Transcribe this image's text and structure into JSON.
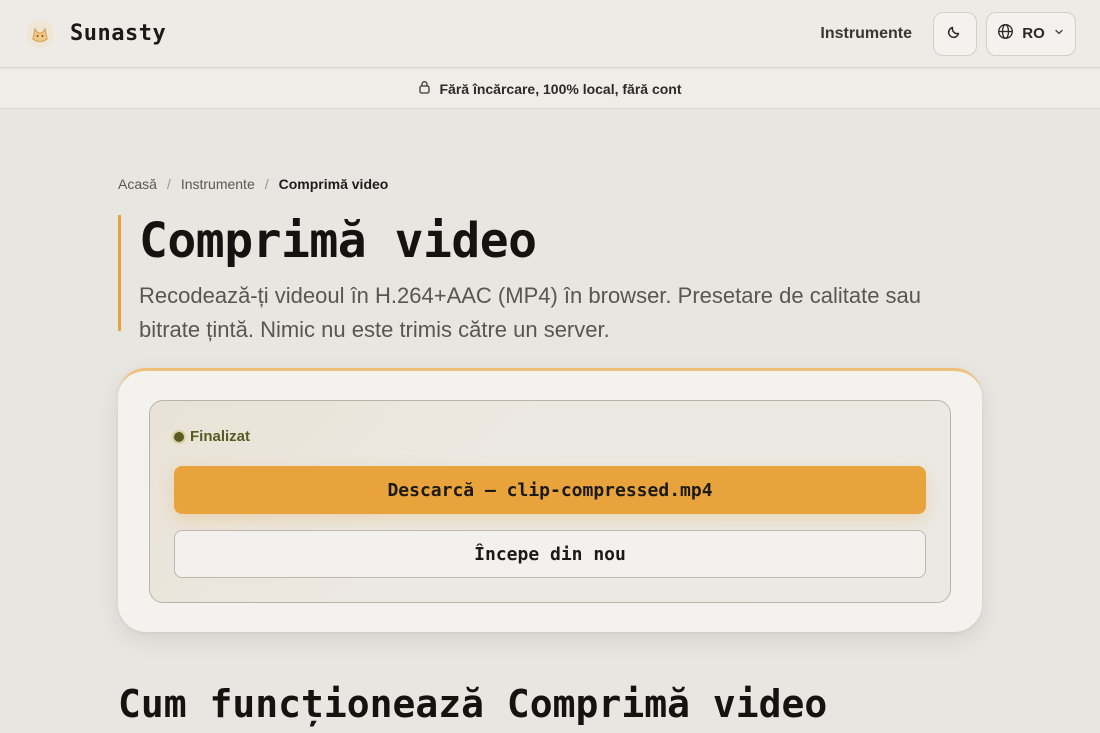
{
  "header": {
    "brand_name": "Sunasty",
    "nav_link": "Instrumente",
    "language": "RO"
  },
  "banner": {
    "text": "Fără încărcare, 100% local, fără cont"
  },
  "breadcrumb": {
    "home": "Acasă",
    "tools": "Instrumente",
    "current": "Comprimă video",
    "separator": "/"
  },
  "hero": {
    "title": "Comprimă video",
    "description": "Recodează-ți videoul în H.264+AAC (MP4) în browser. Presetare de calitate sau bitrate țintă. Nimic nu este trimis către un server."
  },
  "result": {
    "status": "Finalizat",
    "download_label": "Descarcă — clip-compressed.mp4",
    "restart_label": "Începe din nou"
  },
  "section": {
    "title": "Cum funcționează Comprimă video"
  },
  "colors": {
    "accent": "#e8a33c",
    "status": "#5a5a21",
    "background": "#e8e6e1"
  }
}
